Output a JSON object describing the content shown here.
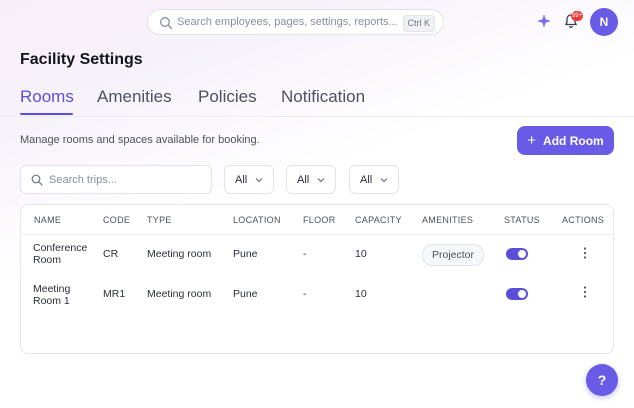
{
  "header": {
    "search_placeholder": "Search employees, pages, settings, reports...",
    "shortcut": "Ctrl K",
    "notification_badge": "99+",
    "avatar_initial": "N"
  },
  "page": {
    "title": "Facility Settings",
    "tabs": [
      {
        "label": "Rooms",
        "active": true
      },
      {
        "label": "Amenities",
        "active": false
      },
      {
        "label": "Policies",
        "active": false
      },
      {
        "label": "Notification",
        "active": false
      }
    ],
    "description": "Manage rooms and spaces available for booking.",
    "add_button": "Add Room"
  },
  "filters": {
    "search_placeholder": "Search trips...",
    "selects": [
      "All",
      "All",
      "All"
    ]
  },
  "table": {
    "columns": [
      "NAME",
      "CODE",
      "TYPE",
      "LOCATION",
      "FLOOR",
      "CAPACITY",
      "AMENITIES",
      "STATUS",
      "ACTIONS"
    ],
    "rows": [
      {
        "name_line1": "Conference",
        "name_line2": "Room",
        "code": "CR",
        "type": "Meeting room",
        "location": "Pune",
        "floor": "-",
        "capacity": "10",
        "amenity": "Projector",
        "status_on": true
      },
      {
        "name_line1": "Meeting",
        "name_line2": "Room 1",
        "code": "MR1",
        "type": "Meeting room",
        "location": "Pune",
        "floor": "-",
        "capacity": "10",
        "amenity": "",
        "status_on": true
      }
    ]
  },
  "help_label": "?",
  "colors": {
    "accent": "#6a5be6",
    "tab_active": "#5b4fd8",
    "badge": "#ea3b3b"
  }
}
